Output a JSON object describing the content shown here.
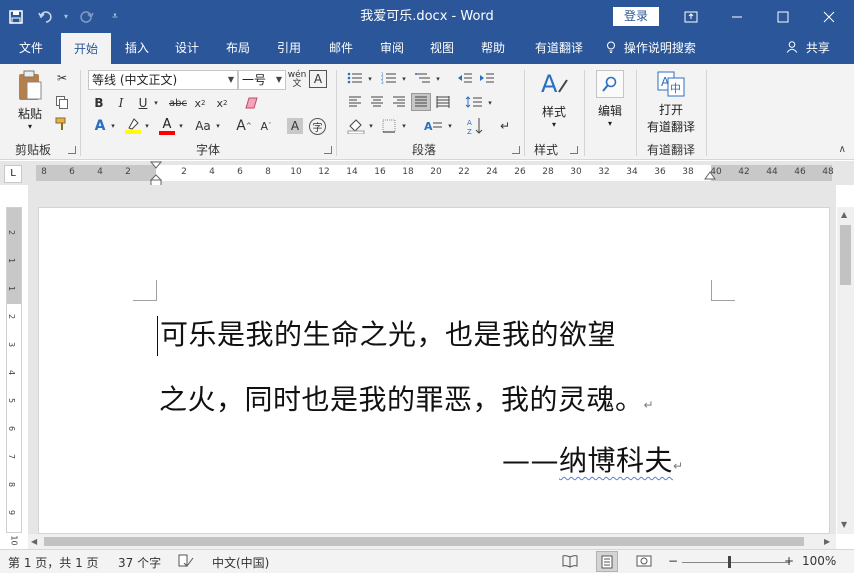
{
  "window": {
    "title": "我爱可乐.docx - Word",
    "login_label": "登录",
    "controls": [
      "ribbon-display-icon",
      "minimize-icon",
      "maximize-icon",
      "close-icon"
    ]
  },
  "qat": {
    "icons": [
      "save-icon",
      "undo-icon",
      "redo-icon",
      "customize-icon"
    ]
  },
  "tabs": [
    "文件",
    "开始",
    "插入",
    "设计",
    "布局",
    "引用",
    "邮件",
    "审阅",
    "视图",
    "帮助",
    "有道翻译"
  ],
  "active_tab": "开始",
  "tell_me": "操作说明搜索",
  "share": "共享",
  "ribbon": {
    "clipboard": {
      "label": "剪贴板",
      "paste": "粘贴"
    },
    "font": {
      "label": "字体",
      "font_name": "等线 (中文正文)",
      "font_size": "一号"
    },
    "paragraph": {
      "label": "段落"
    },
    "styles": {
      "label": "样式",
      "button": "样式"
    },
    "editing": {
      "button": "编辑"
    },
    "youdao": {
      "label": "有道翻译",
      "button_line1": "打开",
      "button_line2": "有道翻译"
    }
  },
  "ruler": {
    "numbers": [
      "8",
      "6",
      "4",
      "2",
      "2",
      "4",
      "6",
      "8",
      "10",
      "12",
      "14",
      "16",
      "18",
      "20",
      "22",
      "24",
      "26",
      "28",
      "30",
      "32",
      "34",
      "36",
      "38",
      "40",
      "42",
      "44",
      "46",
      "48"
    ],
    "vnumbers": [
      "2",
      "1",
      "1",
      "2",
      "3",
      "4",
      "5",
      "6",
      "7",
      "8",
      "9",
      "10"
    ],
    "corner": "L"
  },
  "document": {
    "line1": "可乐是我的生命之光，也是我的欲望",
    "line2": "之火，同时也是我的罪恶，我的灵魂。",
    "dash": "——",
    "author": "纳博科夫",
    "para_mark": "↵"
  },
  "status": {
    "page": "第 1 页，共 1 页",
    "words": "37 个字",
    "language": "中文(中国)",
    "zoom": "100%",
    "zoom_minus": "−",
    "zoom_plus": "+"
  },
  "colors": {
    "accent": "#2b579a",
    "highlight": "#ffff00",
    "font_color": "#ff0000"
  }
}
